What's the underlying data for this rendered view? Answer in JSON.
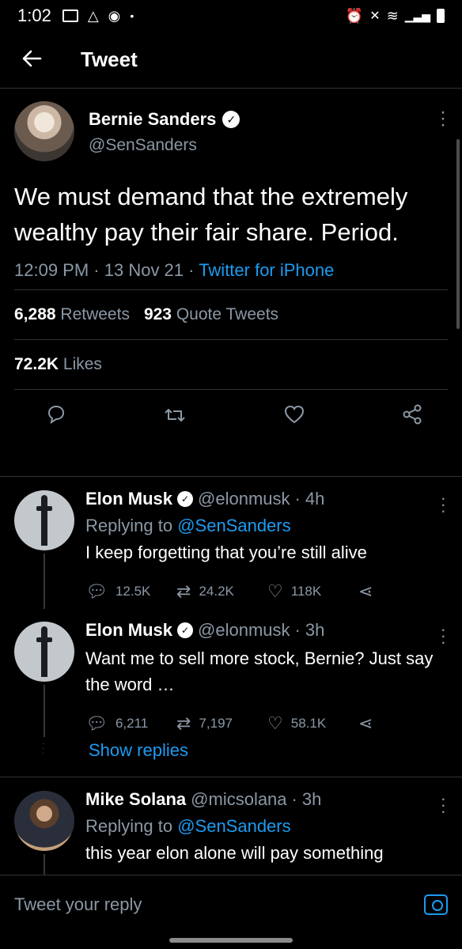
{
  "status_bar": {
    "time": "1:02",
    "dot": "•"
  },
  "header": {
    "back_icon": "arrow-left-icon",
    "title": "Tweet"
  },
  "main_tweet": {
    "name": "Bernie Sanders",
    "handle": "@SenSanders",
    "text": "We must demand that the extremely wealthy pay their fair share. Period.",
    "time": "12:09 PM",
    "date": "13 Nov 21",
    "source": "Twitter for iPhone",
    "retweets_count": "6,288",
    "retweets_label": "Retweets",
    "quotes_count": "923",
    "quotes_label": "Quote Tweets",
    "likes_count": "72.2K",
    "likes_label": "Likes"
  },
  "replies": [
    {
      "name": "Elon Musk",
      "handle": "@elonmusk",
      "age": "4h",
      "replying_prefix": "Replying to",
      "replying_to": "@SenSanders",
      "text": "I keep forgetting that you’re still alive",
      "reply_count": "12.5K",
      "retweet_count": "24.2K",
      "like_count": "118K"
    },
    {
      "name": "Elon Musk",
      "handle": "@elonmusk",
      "age": "3h",
      "text": "Want me to sell more stock, Bernie? Just say the word …",
      "reply_count": "6,211",
      "retweet_count": "7,197",
      "like_count": "58.1K",
      "show_replies": "Show replies"
    },
    {
      "name": "Mike Solana",
      "handle": "@micsolana",
      "age": "3h",
      "replying_prefix": "Replying to",
      "replying_to": "@SenSanders",
      "text": "this year elon alone will pay something"
    }
  ],
  "compose": {
    "placeholder": "Tweet your reply"
  }
}
